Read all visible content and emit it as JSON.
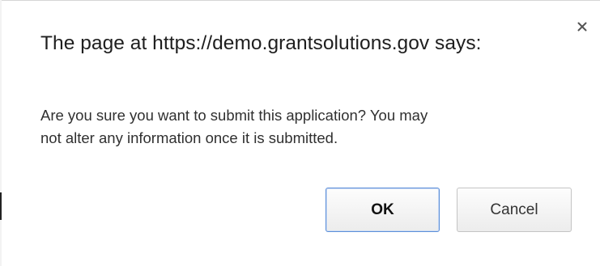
{
  "dialog": {
    "title": "The page at https://demo.grantsolutions.gov says:",
    "close_icon": "close-icon",
    "message_lines": [
      "Are you sure you want to submit this application?  You may",
      "not alter any information once it is submitted."
    ],
    "ok_label": "OK",
    "cancel_label": "Cancel"
  },
  "colors": {
    "background": "#ffffff",
    "ok_border": "#5b8ed8",
    "button_border": "#c4c4c4",
    "text": "#303030"
  }
}
